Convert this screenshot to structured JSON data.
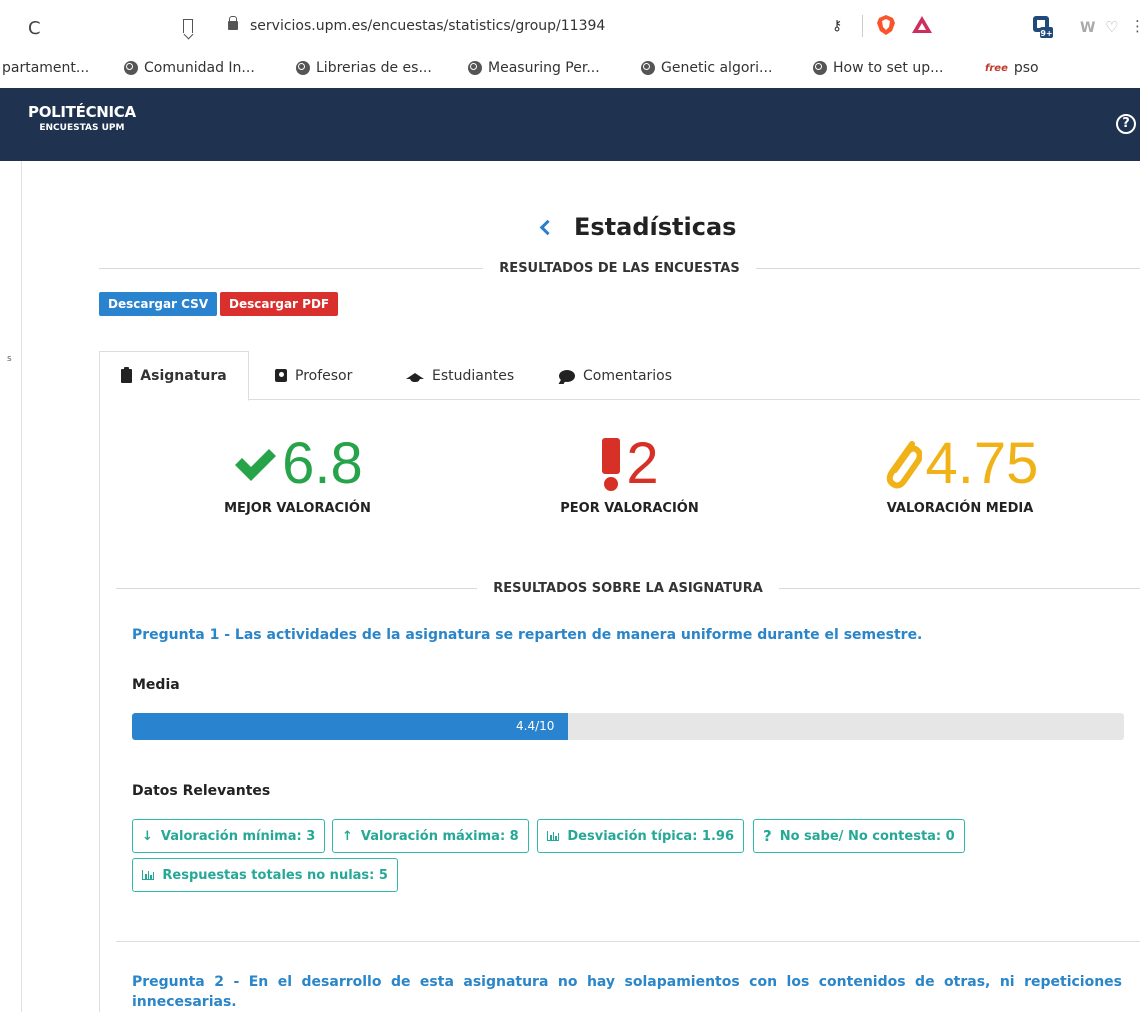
{
  "browser": {
    "url_host": "servicios.upm.es",
    "url_path": "/encuestas/statistics/group/11394",
    "ext_badge": "9+",
    "bookmarks": [
      "partament...",
      "Comunidad In...",
      "Librerias de es...",
      "Measuring Per...",
      "Genetic algori...",
      "How to set up...",
      "pso"
    ],
    "free_label": "free"
  },
  "appbar": {
    "logo_main": "POLITÉCNICA",
    "logo_sub": "ENCUESTAS UPM",
    "help": "?"
  },
  "page": {
    "title": "Estadísticas",
    "results_heading": "RESULTADOS DE LAS ENCUESTAS",
    "btn_csv": "Descargar CSV",
    "btn_pdf": "Descargar PDF",
    "rail_mark": "s"
  },
  "tabs": [
    {
      "label": "Asignatura",
      "icon": "clipboard-icon",
      "active": true
    },
    {
      "label": "Profesor",
      "icon": "contact-card-icon",
      "active": false
    },
    {
      "label": "Estudiantes",
      "icon": "graduation-cap-icon",
      "active": false
    },
    {
      "label": "Comentarios",
      "icon": "comment-icon",
      "active": false
    }
  ],
  "stats": {
    "best": {
      "value": "6.8",
      "label": "MEJOR VALORACIÓN",
      "color": "#27a34a"
    },
    "worst": {
      "value": "2",
      "label": "PEOR VALORACIÓN",
      "color": "#d63027"
    },
    "mean": {
      "value": "4.75",
      "label": "VALORACIÓN MEDIA",
      "color": "#f1b218"
    }
  },
  "subject_heading": "RESULTADOS SOBRE LA ASIGNATURA",
  "q1": {
    "title": "Pregunta 1 - Las actividades de la asignatura se reparten de manera uniforme durante el semestre.",
    "media_label": "Media",
    "media_text": "4.4/10",
    "media_value": 4.4,
    "media_max": 10,
    "relevant_label": "Datos Relevantes",
    "badges": {
      "min": "Valoración mínima: 3",
      "max": "Valoración máxima: 8",
      "sd": "Desviación típica: 1.96",
      "nsnc": "No sabe/ No contesta: 0",
      "total": "Respuestas totales no nulas: 5"
    }
  },
  "q2": {
    "title": "Pregunta 2 - En el desarrollo de esta asignatura no hay solapamientos con los contenidos de otras, ni repeticiones innecesarias."
  },
  "colors": {
    "navy": "#1f3350",
    "accent_blue": "#2a83cf",
    "danger_red": "#d9302e",
    "teal": "#2fb9a8"
  }
}
